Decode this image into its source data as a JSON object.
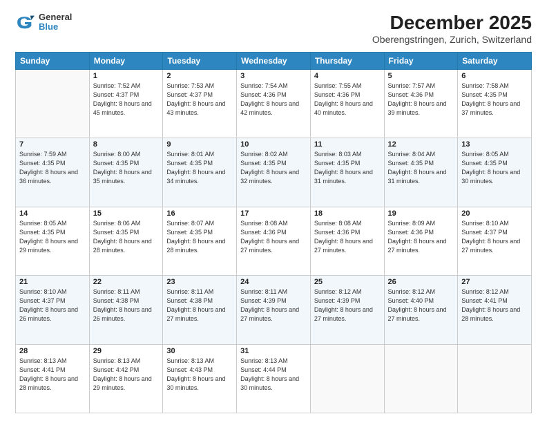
{
  "logo": {
    "line1": "General",
    "line2": "Blue"
  },
  "title": "December 2025",
  "subtitle": "Oberengstringen, Zurich, Switzerland",
  "days_of_week": [
    "Sunday",
    "Monday",
    "Tuesday",
    "Wednesday",
    "Thursday",
    "Friday",
    "Saturday"
  ],
  "weeks": [
    [
      {
        "day": "",
        "sunrise": "",
        "sunset": "",
        "daylight": ""
      },
      {
        "day": "1",
        "sunrise": "Sunrise: 7:52 AM",
        "sunset": "Sunset: 4:37 PM",
        "daylight": "Daylight: 8 hours and 45 minutes."
      },
      {
        "day": "2",
        "sunrise": "Sunrise: 7:53 AM",
        "sunset": "Sunset: 4:37 PM",
        "daylight": "Daylight: 8 hours and 43 minutes."
      },
      {
        "day": "3",
        "sunrise": "Sunrise: 7:54 AM",
        "sunset": "Sunset: 4:36 PM",
        "daylight": "Daylight: 8 hours and 42 minutes."
      },
      {
        "day": "4",
        "sunrise": "Sunrise: 7:55 AM",
        "sunset": "Sunset: 4:36 PM",
        "daylight": "Daylight: 8 hours and 40 minutes."
      },
      {
        "day": "5",
        "sunrise": "Sunrise: 7:57 AM",
        "sunset": "Sunset: 4:36 PM",
        "daylight": "Daylight: 8 hours and 39 minutes."
      },
      {
        "day": "6",
        "sunrise": "Sunrise: 7:58 AM",
        "sunset": "Sunset: 4:35 PM",
        "daylight": "Daylight: 8 hours and 37 minutes."
      }
    ],
    [
      {
        "day": "7",
        "sunrise": "Sunrise: 7:59 AM",
        "sunset": "Sunset: 4:35 PM",
        "daylight": "Daylight: 8 hours and 36 minutes."
      },
      {
        "day": "8",
        "sunrise": "Sunrise: 8:00 AM",
        "sunset": "Sunset: 4:35 PM",
        "daylight": "Daylight: 8 hours and 35 minutes."
      },
      {
        "day": "9",
        "sunrise": "Sunrise: 8:01 AM",
        "sunset": "Sunset: 4:35 PM",
        "daylight": "Daylight: 8 hours and 34 minutes."
      },
      {
        "day": "10",
        "sunrise": "Sunrise: 8:02 AM",
        "sunset": "Sunset: 4:35 PM",
        "daylight": "Daylight: 8 hours and 32 minutes."
      },
      {
        "day": "11",
        "sunrise": "Sunrise: 8:03 AM",
        "sunset": "Sunset: 4:35 PM",
        "daylight": "Daylight: 8 hours and 31 minutes."
      },
      {
        "day": "12",
        "sunrise": "Sunrise: 8:04 AM",
        "sunset": "Sunset: 4:35 PM",
        "daylight": "Daylight: 8 hours and 31 minutes."
      },
      {
        "day": "13",
        "sunrise": "Sunrise: 8:05 AM",
        "sunset": "Sunset: 4:35 PM",
        "daylight": "Daylight: 8 hours and 30 minutes."
      }
    ],
    [
      {
        "day": "14",
        "sunrise": "Sunrise: 8:05 AM",
        "sunset": "Sunset: 4:35 PM",
        "daylight": "Daylight: 8 hours and 29 minutes."
      },
      {
        "day": "15",
        "sunrise": "Sunrise: 8:06 AM",
        "sunset": "Sunset: 4:35 PM",
        "daylight": "Daylight: 8 hours and 28 minutes."
      },
      {
        "day": "16",
        "sunrise": "Sunrise: 8:07 AM",
        "sunset": "Sunset: 4:35 PM",
        "daylight": "Daylight: 8 hours and 28 minutes."
      },
      {
        "day": "17",
        "sunrise": "Sunrise: 8:08 AM",
        "sunset": "Sunset: 4:36 PM",
        "daylight": "Daylight: 8 hours and 27 minutes."
      },
      {
        "day": "18",
        "sunrise": "Sunrise: 8:08 AM",
        "sunset": "Sunset: 4:36 PM",
        "daylight": "Daylight: 8 hours and 27 minutes."
      },
      {
        "day": "19",
        "sunrise": "Sunrise: 8:09 AM",
        "sunset": "Sunset: 4:36 PM",
        "daylight": "Daylight: 8 hours and 27 minutes."
      },
      {
        "day": "20",
        "sunrise": "Sunrise: 8:10 AM",
        "sunset": "Sunset: 4:37 PM",
        "daylight": "Daylight: 8 hours and 27 minutes."
      }
    ],
    [
      {
        "day": "21",
        "sunrise": "Sunrise: 8:10 AM",
        "sunset": "Sunset: 4:37 PM",
        "daylight": "Daylight: 8 hours and 26 minutes."
      },
      {
        "day": "22",
        "sunrise": "Sunrise: 8:11 AM",
        "sunset": "Sunset: 4:38 PM",
        "daylight": "Daylight: 8 hours and 26 minutes."
      },
      {
        "day": "23",
        "sunrise": "Sunrise: 8:11 AM",
        "sunset": "Sunset: 4:38 PM",
        "daylight": "Daylight: 8 hours and 27 minutes."
      },
      {
        "day": "24",
        "sunrise": "Sunrise: 8:11 AM",
        "sunset": "Sunset: 4:39 PM",
        "daylight": "Daylight: 8 hours and 27 minutes."
      },
      {
        "day": "25",
        "sunrise": "Sunrise: 8:12 AM",
        "sunset": "Sunset: 4:39 PM",
        "daylight": "Daylight: 8 hours and 27 minutes."
      },
      {
        "day": "26",
        "sunrise": "Sunrise: 8:12 AM",
        "sunset": "Sunset: 4:40 PM",
        "daylight": "Daylight: 8 hours and 27 minutes."
      },
      {
        "day": "27",
        "sunrise": "Sunrise: 8:12 AM",
        "sunset": "Sunset: 4:41 PM",
        "daylight": "Daylight: 8 hours and 28 minutes."
      }
    ],
    [
      {
        "day": "28",
        "sunrise": "Sunrise: 8:13 AM",
        "sunset": "Sunset: 4:41 PM",
        "daylight": "Daylight: 8 hours and 28 minutes."
      },
      {
        "day": "29",
        "sunrise": "Sunrise: 8:13 AM",
        "sunset": "Sunset: 4:42 PM",
        "daylight": "Daylight: 8 hours and 29 minutes."
      },
      {
        "day": "30",
        "sunrise": "Sunrise: 8:13 AM",
        "sunset": "Sunset: 4:43 PM",
        "daylight": "Daylight: 8 hours and 30 minutes."
      },
      {
        "day": "31",
        "sunrise": "Sunrise: 8:13 AM",
        "sunset": "Sunset: 4:44 PM",
        "daylight": "Daylight: 8 hours and 30 minutes."
      },
      {
        "day": "",
        "sunrise": "",
        "sunset": "",
        "daylight": ""
      },
      {
        "day": "",
        "sunrise": "",
        "sunset": "",
        "daylight": ""
      },
      {
        "day": "",
        "sunrise": "",
        "sunset": "",
        "daylight": ""
      }
    ]
  ]
}
